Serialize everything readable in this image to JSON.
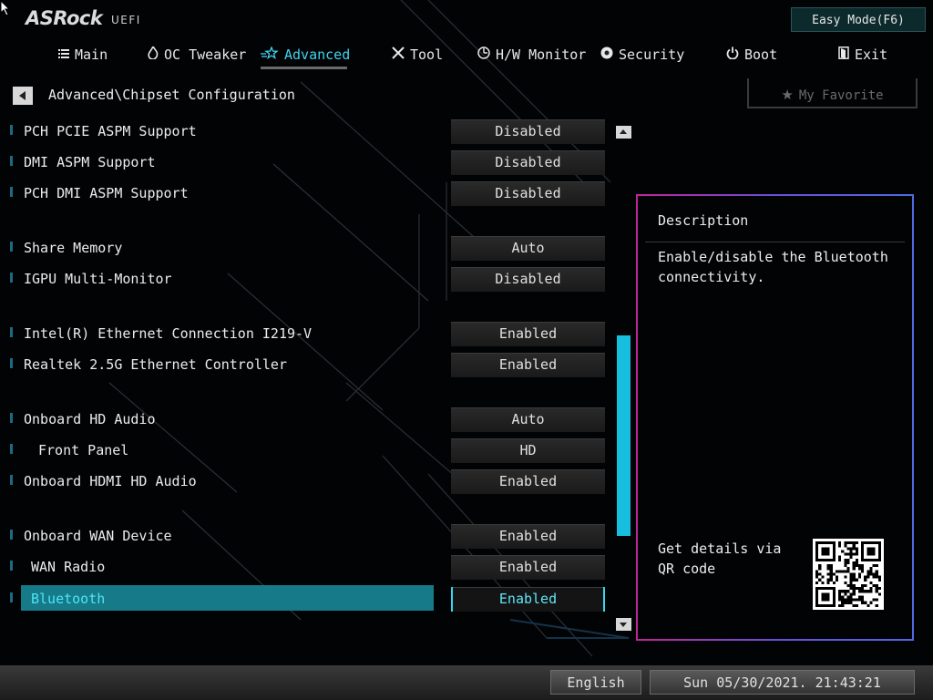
{
  "brand": {
    "logo_text": "ASRock",
    "logo_sub": "UEFI"
  },
  "header": {
    "easy_mode_label": "Easy Mode(F6)"
  },
  "nav": {
    "tabs": [
      {
        "label": "Main",
        "icon": "list-icon"
      },
      {
        "label": "OC Tweaker",
        "icon": "flame-icon"
      },
      {
        "label": "Advanced",
        "icon": "star-icon",
        "active": true
      },
      {
        "label": "Tool",
        "icon": "tools-icon"
      },
      {
        "label": "H/W Monitor",
        "icon": "monitor-dial-icon"
      },
      {
        "label": "Security",
        "icon": "shield-gear-icon"
      },
      {
        "label": "Boot",
        "icon": "power-icon"
      },
      {
        "label": "Exit",
        "icon": "exit-door-icon"
      }
    ]
  },
  "breadcrumb": {
    "path": "Advanced\\Chipset Configuration"
  },
  "favorite": {
    "label": "My Favorite"
  },
  "settings": [
    {
      "label": "PCH PCIE ASPM Support",
      "value": "Disabled"
    },
    {
      "label": "DMI ASPM Support",
      "value": "Disabled"
    },
    {
      "label": "PCH DMI ASPM Support",
      "value": "Disabled"
    },
    {
      "label": "Share Memory",
      "value": "Auto"
    },
    {
      "label": "IGPU Multi-Monitor",
      "value": "Disabled"
    },
    {
      "label": "Intel(R) Ethernet Connection I219-V",
      "value": "Enabled"
    },
    {
      "label": "Realtek 2.5G Ethernet Controller",
      "value": "Enabled"
    },
    {
      "label": "Onboard HD Audio",
      "value": "Auto"
    },
    {
      "label": "Front Panel",
      "value": "HD"
    },
    {
      "label": "Onboard HDMI HD Audio",
      "value": "Enabled"
    },
    {
      "label": "Onboard WAN Device",
      "value": "Enabled"
    },
    {
      "label": "WAN Radio",
      "value": "Enabled"
    },
    {
      "label": "Bluetooth",
      "value": "Enabled",
      "selected": true
    }
  ],
  "description": {
    "title": "Description",
    "text": "Enable/disable the Bluetooth connectivity.",
    "qr_text": "Get details via QR code"
  },
  "footer": {
    "language": "English",
    "datetime": "Sun 05/30/2021. 21:43:21"
  },
  "colors": {
    "accent": "#3fd3f0",
    "selection_bg": "#167a88",
    "scroll_thumb": "#18bede",
    "panel_border_start": "#c1249a",
    "panel_border_end": "#4f6ae0"
  }
}
